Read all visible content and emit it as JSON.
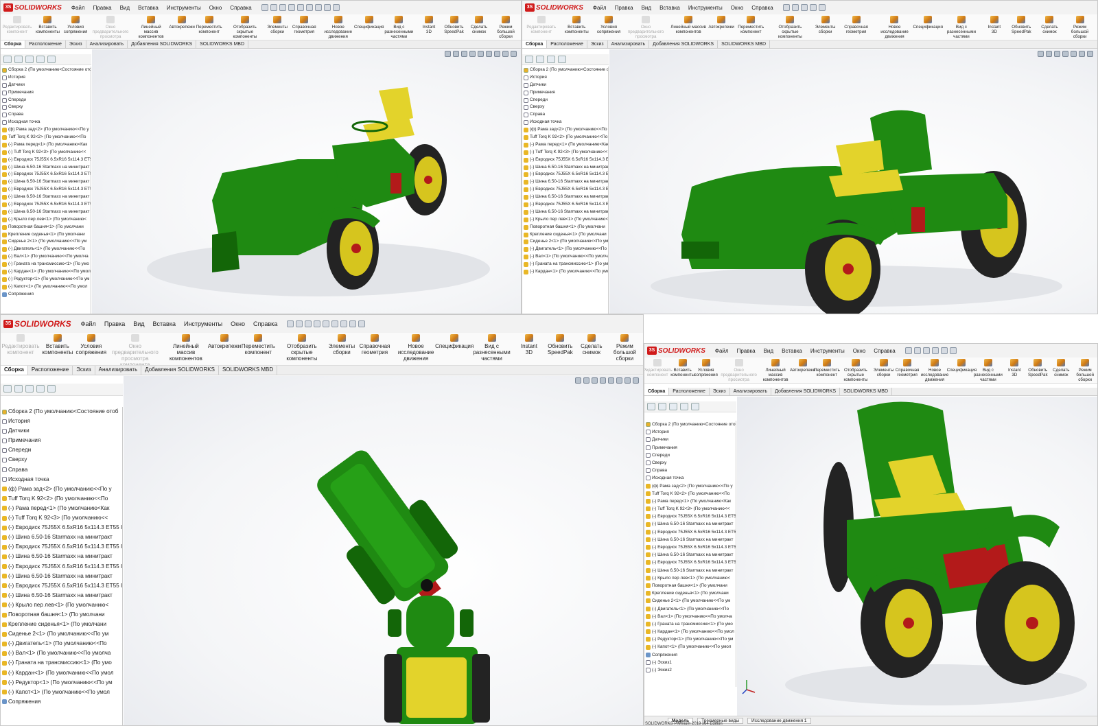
{
  "app": {
    "name": "SOLIDWORKS",
    "brand_color": "#d01a1a"
  },
  "menu": [
    "Файл",
    "Правка",
    "Вид",
    "Вставка",
    "Инструменты",
    "Окно",
    "Справка"
  ],
  "toolbar": [
    {
      "label": "Редактировать компонент",
      "enabled": false
    },
    {
      "label": "Вставить компоненты",
      "enabled": true
    },
    {
      "label": "Условия сопряжения",
      "enabled": true
    },
    {
      "label": "Окно предварительного просмотра компонента",
      "enabled": false
    },
    {
      "label": "Линейный массив компонентов",
      "enabled": true
    },
    {
      "label": "Автокрепежи",
      "enabled": true
    },
    {
      "label": "Переместить компонент",
      "enabled": true
    },
    {
      "label": "Отобразить скрытые компоненты",
      "enabled": true
    },
    {
      "label": "Элементы сборки",
      "enabled": true
    },
    {
      "label": "Справочная геометрия",
      "enabled": true
    },
    {
      "label": "Новое исследование движения",
      "enabled": true
    },
    {
      "label": "Спецификация",
      "enabled": true
    },
    {
      "label": "Вид с разнесенными частями",
      "enabled": true
    },
    {
      "label": "Instant 3D",
      "enabled": true
    },
    {
      "label": "Обновить SpeedPak",
      "enabled": true
    },
    {
      "label": "Сделать снимок",
      "enabled": true
    },
    {
      "label": "Режим большой сборки",
      "enabled": true
    }
  ],
  "tabs": [
    "Сборка",
    "Расположение",
    "Эскиз",
    "Анализировать",
    "Добавления SOLIDWORKS",
    "SOLIDWORKS MBD"
  ],
  "tree": [
    {
      "label": "Сборка 2  (По умолчанию<Состояние отоб",
      "icon": "asm"
    },
    {
      "label": "История",
      "icon": "fold"
    },
    {
      "label": "Датчики",
      "icon": "fold"
    },
    {
      "label": "Примечания",
      "icon": "fold"
    },
    {
      "label": "Спереди",
      "icon": "fold"
    },
    {
      "label": "Сверху",
      "icon": "fold"
    },
    {
      "label": "Справа",
      "icon": "fold"
    },
    {
      "label": "Исходная точка",
      "icon": "fold"
    },
    {
      "label": "(ф) Рама зад<2> (По умолчанию<<По у",
      "icon": "comp"
    },
    {
      "label": "Tuff Torq K 92<2> (По умолчанию<<По",
      "icon": "comp"
    },
    {
      "label": "(-) Рама перед<1> (По умолчанию<Как",
      "icon": "comp"
    },
    {
      "label": "(-) Tuff Torq K 92<3> (По умолчанию<<",
      "icon": "comp"
    },
    {
      "label": "(-) Евродиск 75J55X 6.5xR16 5x114.3 ET55 I",
      "icon": "comp"
    },
    {
      "label": "(-) Шина 6.50-16 Starmaxx на минитракт",
      "icon": "comp"
    },
    {
      "label": "(-) Евродиск 75J55X 6.5xR16 5x114.3 ET55 I",
      "icon": "comp"
    },
    {
      "label": "(-) Шина 6.50-16 Starmaxx на минитракт",
      "icon": "comp"
    },
    {
      "label": "(-) Евродиск 75J55X 6.5xR16 5x114.3 ET55 I",
      "icon": "comp"
    },
    {
      "label": "(-) Шина 6.50-16 Starmaxx на минитракт",
      "icon": "comp"
    },
    {
      "label": "(-) Евродиск 75J55X 6.5xR16 5x114.3 ET55 I",
      "icon": "comp"
    },
    {
      "label": "(-) Шина 6.50-16 Starmaxx на минитракт",
      "icon": "comp"
    },
    {
      "label": "(-) Крыло пер лев<1> (По умолчанию<",
      "icon": "comp"
    },
    {
      "label": "Поворотная башня<1> (По умолчани",
      "icon": "comp"
    },
    {
      "label": "Крепление сиденья<1> (По умолчани",
      "icon": "comp"
    },
    {
      "label": "Сиденье 2<1> (По умолчанию<<По ум",
      "icon": "comp"
    },
    {
      "label": "(-) Двигатель<1> (По умолчанию<<По",
      "icon": "comp"
    },
    {
      "label": "(-) Вал<1> (По умолчанию<<По умолча",
      "icon": "comp"
    },
    {
      "label": "(-) Граната на трансмиссию<1> (По умо",
      "icon": "comp"
    },
    {
      "label": "(-) Кардан<1> (По умолчанию<<По умол",
      "icon": "comp"
    },
    {
      "label": "(-) Редуктор<1> (По умолчанию<<По ум",
      "icon": "comp"
    },
    {
      "label": "(-) Капот<1> (По умолчанию<<По умол",
      "icon": "comp"
    },
    {
      "label": "Сопряжения",
      "icon": "mate"
    },
    {
      "label": "(-) Эскиз1",
      "icon": "fold"
    },
    {
      "label": "(-) Эскиз2",
      "icon": "fold"
    }
  ],
  "status_tabs": [
    "Модель",
    "Трехмерные виды",
    "Исследование движения 1"
  ],
  "footer": "SOLIDWORKS Premium 2019 x64 Edition",
  "colors": {
    "body_green": "#1f8a12",
    "body_dark": "#136608",
    "seat_yellow": "#e3d32b",
    "rim_yellow": "#d6c51e",
    "tire": "#232323",
    "accent_red": "#b31a1a"
  }
}
